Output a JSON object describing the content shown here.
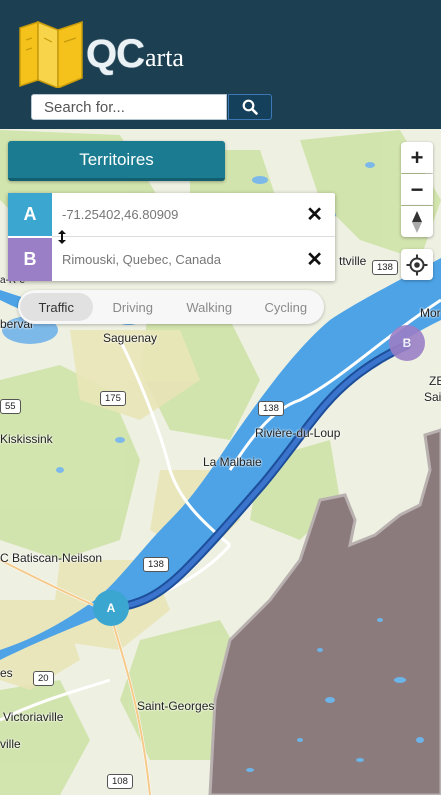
{
  "header": {
    "brand_main": "QC",
    "brand_rest": "arta",
    "logo_icon": "folded-map-icon"
  },
  "search": {
    "placeholder": "Search for...",
    "button_icon": "search-icon"
  },
  "territoires": {
    "label": "Territoires"
  },
  "route": {
    "origin": {
      "marker": "A",
      "value": "-71.25402,46.80909",
      "clear_icon": "close-icon"
    },
    "destination": {
      "marker": "B",
      "value": "Rimouski, Quebec, Canada",
      "clear_icon": "close-icon"
    },
    "swap_icon": "swap-vertical-icon"
  },
  "modes": [
    {
      "label": "Traffic",
      "active": true
    },
    {
      "label": "Driving",
      "active": false
    },
    {
      "label": "Walking",
      "active": false
    },
    {
      "label": "Cycling",
      "active": false
    }
  ],
  "map_controls": {
    "zoom_in": "+",
    "zoom_out": "−",
    "compass_icon": "compass-icon",
    "locate_icon": "locate-icon"
  },
  "map": {
    "places": {
      "saguenay": "Saguenay",
      "laMalbaie": "La Malbaie",
      "riviereDuLoup": "Rivière-du-Loup",
      "kiskissink": "Kiskissink",
      "batiscan": "C Batiscan-Neilson",
      "victoriaville": "Victoriaville",
      "stGeorges": "Saint-Georges",
      "roberval": "berval",
      "ville": "ville",
      "les": "es",
      "ttville": "ttville",
      "mor": "Mor",
      "ze": "ZE",
      "sai": "Sai",
      "aRe": "a-R-e"
    },
    "roads": {
      "r175": "175",
      "r138a": "138",
      "r138b": "138",
      "r138c": "138",
      "r55": "55",
      "r20": "20",
      "r108": "108"
    },
    "pins": {
      "a": "A",
      "b": "B"
    },
    "colors": {
      "water": "#4da3e6",
      "route": "#2f62b8",
      "territory": "#8b7b7d",
      "pin_a": "#3ba6d0",
      "pin_b": "#9b7fc6",
      "header": "#1c3f52",
      "accent": "#1b7c91"
    }
  }
}
